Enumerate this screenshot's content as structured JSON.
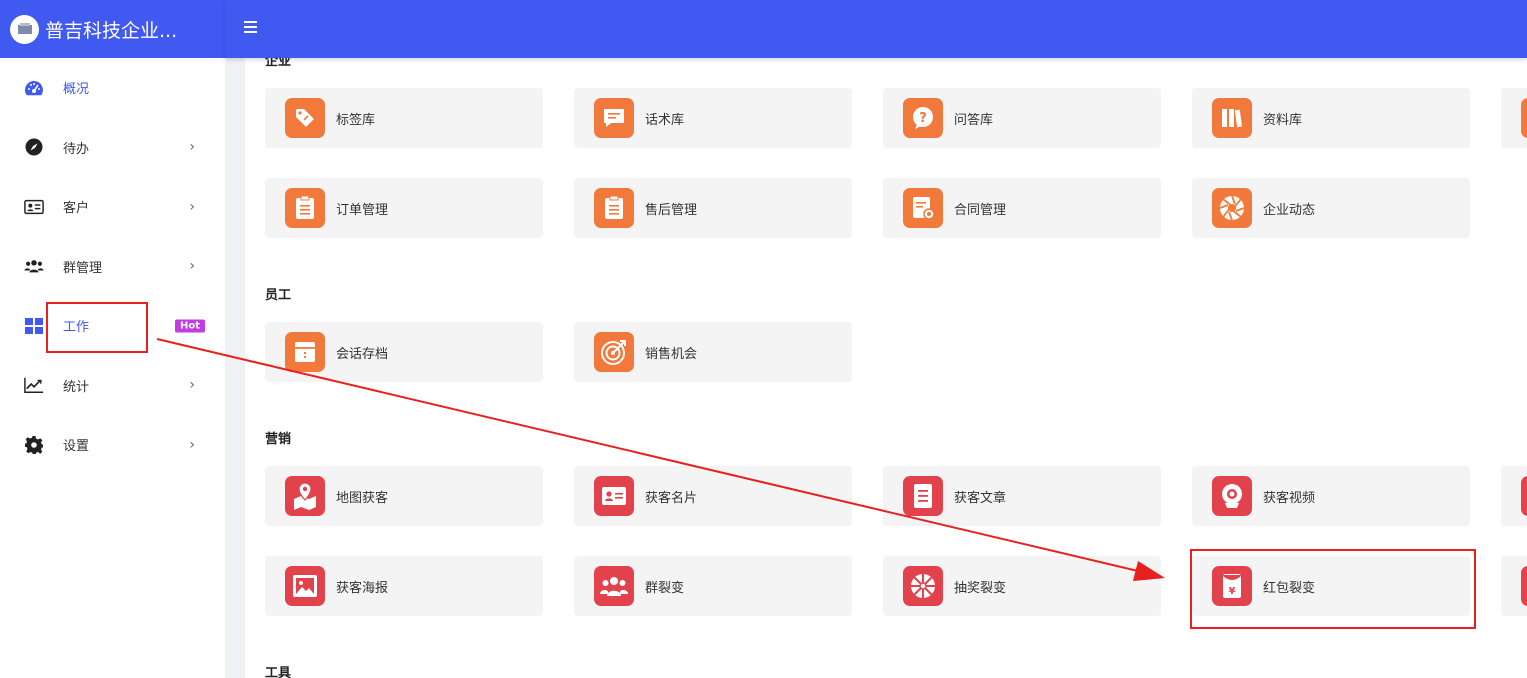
{
  "brand": {
    "title": "普吉科技企业..."
  },
  "sidebar": {
    "items": [
      {
        "label": "概况",
        "icon": "dashboard-icon",
        "has_chevron": false,
        "active": true
      },
      {
        "label": "待办",
        "icon": "compass-icon",
        "has_chevron": true
      },
      {
        "label": "客户",
        "icon": "id-card-icon",
        "has_chevron": true
      },
      {
        "label": "群管理",
        "icon": "users-icon",
        "has_chevron": true
      },
      {
        "label": "工作",
        "icon": "grid-icon",
        "has_chevron": false,
        "badge": "Hot"
      },
      {
        "label": "统计",
        "icon": "chart-line-icon",
        "has_chevron": true
      },
      {
        "label": "设置",
        "icon": "gear-icon",
        "has_chevron": true
      }
    ]
  },
  "sections": {
    "enterprise": {
      "title": "企业",
      "cards": [
        {
          "label": "标签库",
          "icon": "tag-icon"
        },
        {
          "label": "话术库",
          "icon": "message-icon"
        },
        {
          "label": "问答库",
          "icon": "question-icon"
        },
        {
          "label": "资料库",
          "icon": "books-icon"
        },
        {
          "label": "订单管理",
          "icon": "clipboard-icon"
        },
        {
          "label": "售后管理",
          "icon": "clipboard-icon"
        },
        {
          "label": "合同管理",
          "icon": "contract-icon"
        },
        {
          "label": "企业动态",
          "icon": "aperture-icon"
        }
      ]
    },
    "staff": {
      "title": "员工",
      "cards": [
        {
          "label": "会话存档",
          "icon": "archive-icon"
        },
        {
          "label": "销售机会",
          "icon": "target-icon"
        }
      ]
    },
    "marketing": {
      "title": "营销",
      "cards": [
        {
          "label": "地图获客",
          "icon": "map-pin-icon"
        },
        {
          "label": "获客名片",
          "icon": "business-card-icon"
        },
        {
          "label": "获客文章",
          "icon": "article-icon"
        },
        {
          "label": "获客视频",
          "icon": "video-icon"
        },
        {
          "label": "获客海报",
          "icon": "image-icon"
        },
        {
          "label": "群裂变",
          "icon": "group-icon"
        },
        {
          "label": "抽奖裂变",
          "icon": "lottery-wheel-icon"
        },
        {
          "label": "红包裂变",
          "icon": "red-envelope-icon"
        }
      ]
    },
    "tools": {
      "title": "工具"
    }
  },
  "colors": {
    "header": "#4059f0",
    "orange_icon": "#f0793b",
    "red_icon": "#e1424c",
    "annotation": "#e8201e"
  }
}
